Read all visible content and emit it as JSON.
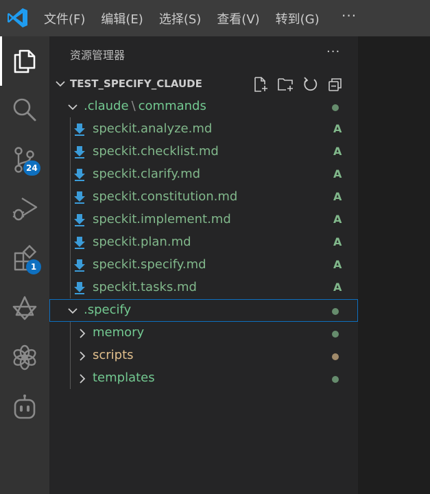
{
  "menu": {
    "file": "文件(F)",
    "edit": "编辑(E)",
    "select": "选择(S)",
    "view": "查看(V)",
    "goto": "转到(G)",
    "more": "···"
  },
  "activity_bar": {
    "items": [
      {
        "icon": "files-icon",
        "active": true
      },
      {
        "icon": "search-icon"
      },
      {
        "icon": "source-control-icon",
        "badge": "24"
      },
      {
        "icon": "run-debug-icon"
      },
      {
        "icon": "extensions-icon",
        "badge": "1"
      },
      {
        "icon": "claude-icon"
      },
      {
        "icon": "openai-icon"
      },
      {
        "icon": "copilot-icon"
      }
    ]
  },
  "explorer": {
    "title": "资源管理器",
    "more": "···",
    "section_title": "TEST_SPECIFY_CLAUDE",
    "tree": {
      "claude_folder": ".claude",
      "commands_folder": "commands",
      "files": [
        {
          "name": "speckit.analyze.md",
          "status": "A"
        },
        {
          "name": "speckit.checklist.md",
          "status": "A"
        },
        {
          "name": "speckit.clarify.md",
          "status": "A"
        },
        {
          "name": "speckit.constitution.md",
          "status": "A"
        },
        {
          "name": "speckit.implement.md",
          "status": "A"
        },
        {
          "name": "speckit.plan.md",
          "status": "A"
        },
        {
          "name": "speckit.specify.md",
          "status": "A"
        },
        {
          "name": "speckit.tasks.md",
          "status": "A"
        }
      ],
      "specify_folder": ".specify",
      "subfolders": [
        {
          "name": "memory",
          "state": "added"
        },
        {
          "name": "scripts",
          "state": "modified"
        },
        {
          "name": "templates",
          "state": "added"
        }
      ]
    }
  },
  "colors": {
    "added": "#81b88b",
    "modified": "#e2c08d",
    "accent": "#0e70c0",
    "download_icon": "#3b9cd9"
  }
}
